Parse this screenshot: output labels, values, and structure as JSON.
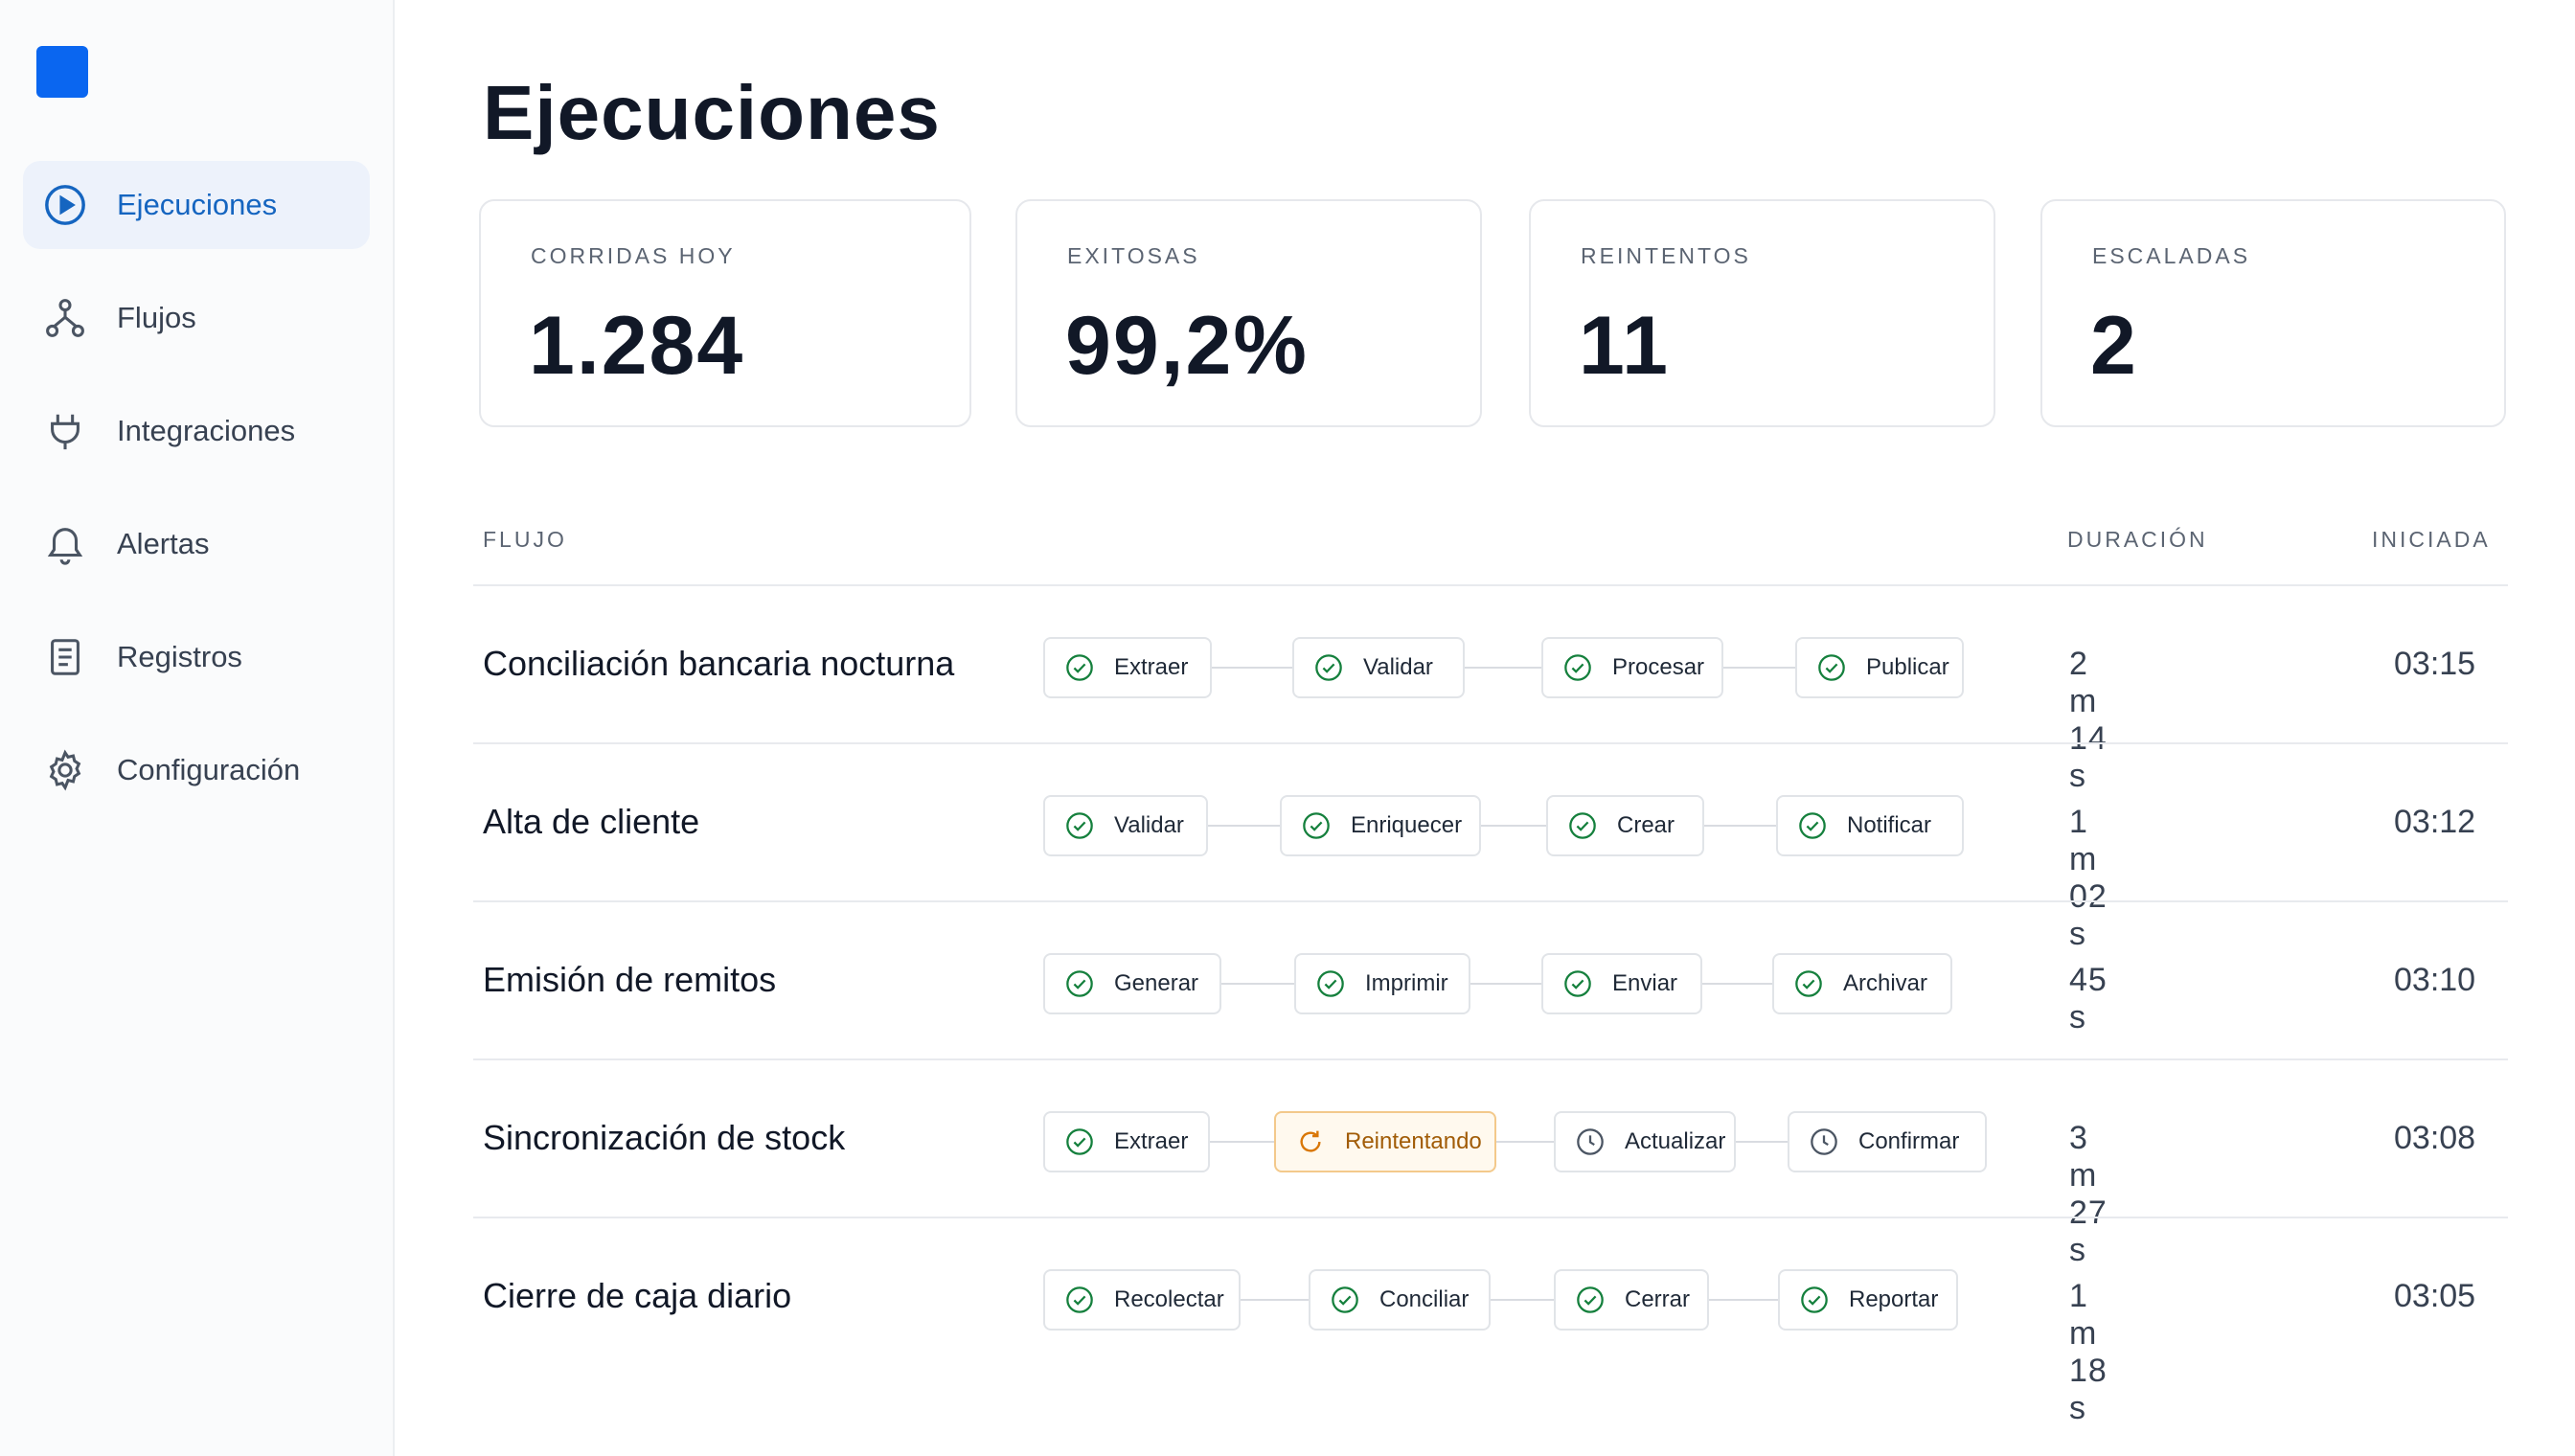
{
  "sidebar": {
    "items": [
      {
        "label": "Ejecuciones",
        "icon": "play-circle-icon",
        "active": true
      },
      {
        "label": "Flujos",
        "icon": "flow-icon",
        "active": false
      },
      {
        "label": "Integraciones",
        "icon": "plug-icon",
        "active": false
      },
      {
        "label": "Alertas",
        "icon": "bell-icon",
        "active": false
      },
      {
        "label": "Registros",
        "icon": "document-icon",
        "active": false
      },
      {
        "label": "Configuración",
        "icon": "gear-icon",
        "active": false
      }
    ]
  },
  "page": {
    "title": "Ejecuciones"
  },
  "stats": [
    {
      "label": "CORRIDAS HOY",
      "value": "1.284"
    },
    {
      "label": "EXITOSAS",
      "value": "99,2%"
    },
    {
      "label": "REINTENTOS",
      "value": "11"
    },
    {
      "label": "ESCALADAS",
      "value": "2"
    }
  ],
  "table": {
    "headers": {
      "flow": "FLUJO",
      "duration": "DURACIÓN",
      "started": "INICIADA"
    },
    "rows": [
      {
        "name": "Conciliación bancaria nocturna",
        "duration": "2 m 14 s",
        "started": "03:15",
        "steps": [
          {
            "label": "Extraer",
            "status": "done"
          },
          {
            "label": "Validar",
            "status": "done"
          },
          {
            "label": "Procesar",
            "status": "done"
          },
          {
            "label": "Publicar",
            "status": "done"
          }
        ]
      },
      {
        "name": "Alta de cliente",
        "duration": "1 m 02 s",
        "started": "03:12",
        "steps": [
          {
            "label": "Validar",
            "status": "done"
          },
          {
            "label": "Enriquecer",
            "status": "done"
          },
          {
            "label": "Crear",
            "status": "done"
          },
          {
            "label": "Notificar",
            "status": "done"
          }
        ]
      },
      {
        "name": "Emisión de remitos",
        "duration": "45 s",
        "started": "03:10",
        "steps": [
          {
            "label": "Generar",
            "status": "done"
          },
          {
            "label": "Imprimir",
            "status": "done"
          },
          {
            "label": "Enviar",
            "status": "done"
          },
          {
            "label": "Archivar",
            "status": "done"
          }
        ]
      },
      {
        "name": "Sincronización de stock",
        "duration": "3 m 27 s",
        "started": "03:08",
        "steps": [
          {
            "label": "Extraer",
            "status": "done"
          },
          {
            "label": "Reintentando",
            "status": "retrying"
          },
          {
            "label": "Actualizar",
            "status": "pending"
          },
          {
            "label": "Confirmar",
            "status": "pending"
          }
        ]
      },
      {
        "name": "Cierre de caja diario",
        "duration": "1 m 18 s",
        "started": "03:05",
        "steps": [
          {
            "label": "Recolectar",
            "status": "done"
          },
          {
            "label": "Conciliar",
            "status": "done"
          },
          {
            "label": "Cerrar",
            "status": "done"
          },
          {
            "label": "Reportar",
            "status": "done"
          }
        ]
      }
    ]
  },
  "colors": {
    "accent": "#0a66f0",
    "active_text": "#1565c0",
    "done": "#15803d",
    "retrying": "#d97706",
    "pending": "#4b5563"
  }
}
